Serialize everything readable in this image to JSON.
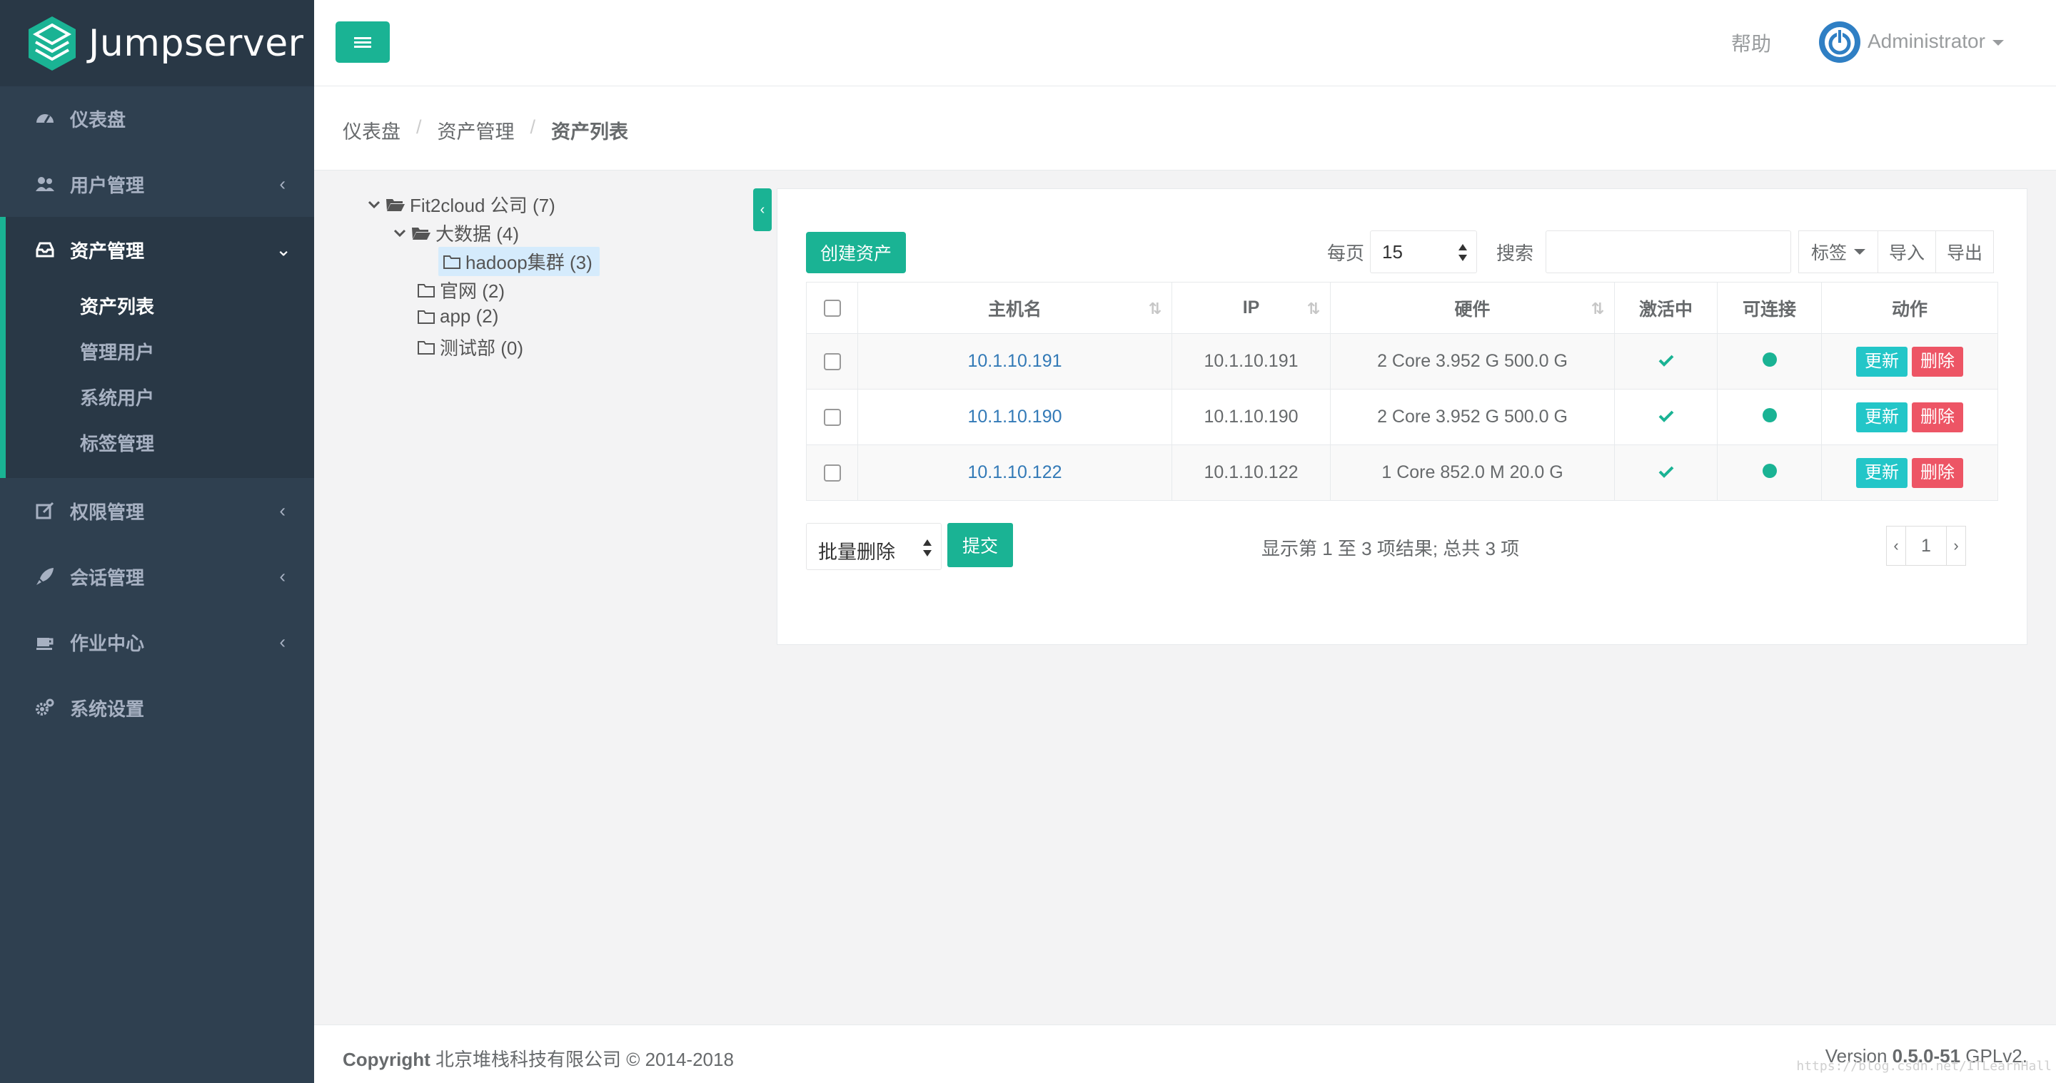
{
  "app": {
    "name": "Jumpserver"
  },
  "sidebar": {
    "items": [
      {
        "label": "仪表盘",
        "icon": "dashboard-icon"
      },
      {
        "label": "用户管理",
        "icon": "users-icon"
      },
      {
        "label": "资产管理",
        "icon": "inbox-icon",
        "active": true,
        "sub": [
          {
            "label": "资产列表",
            "active": true
          },
          {
            "label": "管理用户"
          },
          {
            "label": "系统用户"
          },
          {
            "label": "标签管理"
          }
        ]
      },
      {
        "label": "权限管理",
        "icon": "edit-icon"
      },
      {
        "label": "会话管理",
        "icon": "rocket-icon"
      },
      {
        "label": "作业中心",
        "icon": "coffee-icon"
      },
      {
        "label": "系统设置",
        "icon": "gears-icon"
      }
    ]
  },
  "topbar": {
    "help": "帮助",
    "user": "Administrator"
  },
  "breadcrumb": [
    "仪表盘",
    "资产管理",
    "资产列表"
  ],
  "tree": {
    "root": "Fit2cloud 公司 (7)",
    "bigdata": "大数据 (4)",
    "hadoop": "hadoop集群 (3)",
    "website": "官网 (2)",
    "app": "app (2)",
    "test": "测试部 (0)"
  },
  "toolbar": {
    "create": "创建资产",
    "per_page_label": "每页",
    "per_page_value": "15",
    "search_label": "搜索",
    "search_value": "",
    "tags": "标签",
    "import": "导入",
    "export": "导出"
  },
  "table": {
    "headers": [
      "主机名",
      "IP",
      "硬件",
      "激活中",
      "可连接",
      "动作"
    ],
    "rows": [
      {
        "hostname": "10.1.10.191",
        "ip": "10.1.10.191",
        "hardware": "2 Core 3.952 G 500.0 G"
      },
      {
        "hostname": "10.1.10.190",
        "ip": "10.1.10.190",
        "hardware": "2 Core 3.952 G 500.0 G"
      },
      {
        "hostname": "10.1.10.122",
        "ip": "10.1.10.122",
        "hardware": "1 Core 852.0 M 20.0 G"
      }
    ],
    "update_label": "更新",
    "delete_label": "删除"
  },
  "bulk": {
    "action": "批量删除",
    "submit": "提交"
  },
  "paging": {
    "info": "显示第 1 至 3 项结果; 总共 3 项",
    "prev": "‹",
    "page": "1",
    "next": "›"
  },
  "footer": {
    "copyright_bold": "Copyright",
    "copyright_rest": " 北京堆栈科技有限公司 © 2014-2018",
    "version_label": "Version ",
    "version_num": "0.5.0-51",
    "version_rest": " GPLv2."
  },
  "watermark": "https://blog.csdn.net/ITLearnHall",
  "colors": {
    "accent": "#1ab394",
    "sidebar": "#2f4050",
    "danger": "#ed5565",
    "info": "#23c6c8",
    "link": "#337ab7"
  }
}
